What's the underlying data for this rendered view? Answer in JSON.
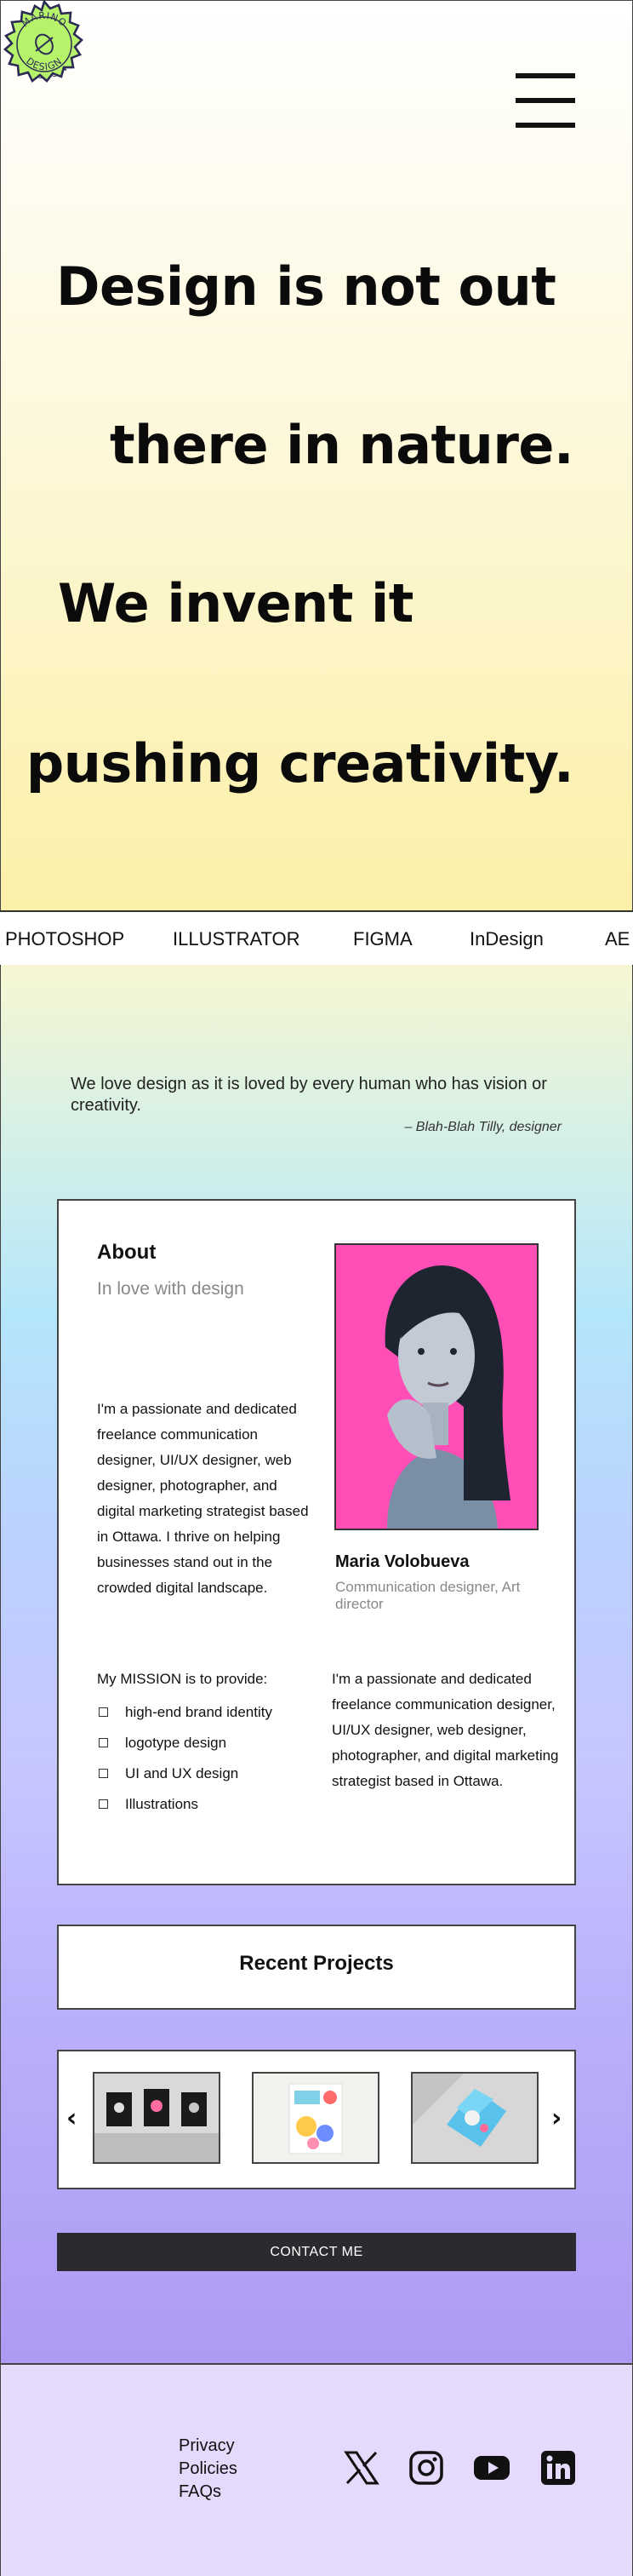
{
  "brand": {
    "badge_text": "MARINO DESIGN"
  },
  "hero": {
    "lines": [
      "Design is not out",
      "there in nature.",
      "We invent it",
      "pushing creativity."
    ]
  },
  "skills_ticker": [
    "PHOTOSHOP",
    "ILLUSTRATOR",
    "FIGMA",
    "InDesign",
    "AE"
  ],
  "quote": {
    "text": "We love design as it is loved by every human who has vision or creativity.",
    "author": "– Blah-Blah Tilly, designer"
  },
  "about": {
    "title": "About",
    "subtitle": "In love with design",
    "intro": "I'm a passionate and dedicated freelance communication designer, UI/UX designer, web designer, photographer, and digital marketing strategist based in Ottawa. I thrive on helping businesses stand out in the crowded digital landscape.",
    "name": "Maria Volobueva",
    "role": "Communication designer, Art director",
    "mission_title": "My MISSION is to provide:",
    "mission_items": [
      "high-end brand identity",
      "logotype design",
      "UI and UX design",
      "Illustrations"
    ],
    "bio": "I'm a passionate and dedicated freelance communication designer, UI/UX designer, web designer, photographer, and digital marketing strategist based in Ottawa."
  },
  "projects": {
    "title": "Recent Projects",
    "prev_arrow": "‹",
    "next_arrow": "›"
  },
  "contact_label": "CONTACT ME",
  "footer": {
    "links": [
      "Privacy",
      "Policies",
      "FAQs"
    ]
  },
  "colors": {
    "badge_fill": "#b6f36a",
    "photo_bg": "#ff4fb7",
    "button_bg": "#2b2b2f",
    "footer_bg": "#e5d9fc"
  }
}
